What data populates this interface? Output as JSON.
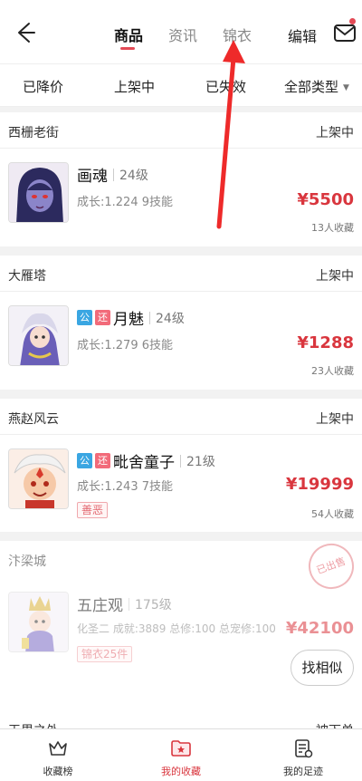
{
  "nav": {
    "tabs": [
      {
        "label": "商品",
        "active": true
      },
      {
        "label": "资讯",
        "active": false
      },
      {
        "label": "锦衣",
        "active": false
      }
    ],
    "edit_label": "编辑",
    "accent_color": "#e34a55"
  },
  "filters": [
    {
      "label": "已降价"
    },
    {
      "label": "上架中"
    },
    {
      "label": "已失效"
    },
    {
      "label": "全部类型",
      "caret": "▼"
    }
  ],
  "items": [
    {
      "server": "西栅老街",
      "status": "上架中",
      "tags": [],
      "name": "画魂",
      "level": "24级",
      "growth": "成长:1.224 9技能",
      "price": "¥5500",
      "favorites": "13人收藏"
    },
    {
      "server": "大雁塔",
      "status": "上架中",
      "tags": [
        "公",
        "还"
      ],
      "name": "月魅",
      "level": "24级",
      "growth": "成长:1.279 6技能",
      "price": "¥1288",
      "favorites": "23人收藏"
    },
    {
      "server": "燕赵风云",
      "status": "上架中",
      "tags": [
        "公",
        "还"
      ],
      "name": "毗舍童子",
      "level": "21级",
      "growth": "成长:1.243 7技能",
      "price": "¥19999",
      "favorites": "54人收藏",
      "badge": "善恶"
    },
    {
      "server": "汴梁城",
      "status": "",
      "stamp": "已出售",
      "tags": [],
      "name": "五庄观",
      "level": "175级",
      "growth": "化圣二 成就:3889 总修:100 总宠修:100",
      "price": "¥42100",
      "badge": "锦衣25件",
      "similar_label": "找相似"
    },
    {
      "server": "天里之外",
      "status": "被下单"
    }
  ],
  "bottom_nav": [
    {
      "label": "收藏榜",
      "icon": "crown-icon"
    },
    {
      "label": "我的收藏",
      "icon": "folder-star-icon",
      "active": true
    },
    {
      "label": "我的足迹",
      "icon": "footprint-list-icon"
    }
  ]
}
